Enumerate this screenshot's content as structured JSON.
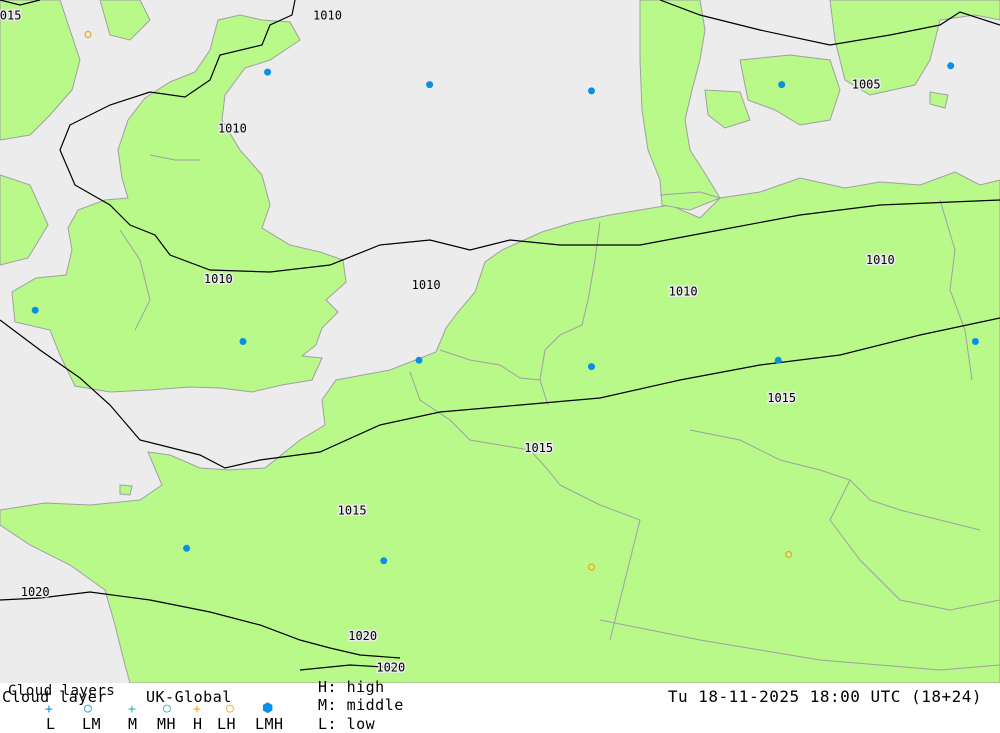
{
  "map": {
    "colors": {
      "sea": "#ececec",
      "land": "#b8f98a",
      "border": "#a0a0a0",
      "isobar": "#000000",
      "cloud_dot": "#0a8fe6",
      "low_ring": "#f4a21a"
    },
    "isobar_labels": [
      {
        "text": "015",
        "lon": -10.9,
        "lat": 59.4
      },
      {
        "text": "1010",
        "lon": -1.9,
        "lat": 59.4
      },
      {
        "text": "1010",
        "lon": -4.6,
        "lat": 57.6
      },
      {
        "text": "1005",
        "lon": 13.4,
        "lat": 58.3
      },
      {
        "text": "1010",
        "lon": -5.0,
        "lat": 55.2
      },
      {
        "text": "1010",
        "lon": 0.9,
        "lat": 55.1
      },
      {
        "text": "1010",
        "lon": 8.2,
        "lat": 55.0
      },
      {
        "text": "1010",
        "lon": 13.8,
        "lat": 55.5
      },
      {
        "text": "1015",
        "lon": 11.0,
        "lat": 53.3
      },
      {
        "text": "1015",
        "lon": 4.1,
        "lat": 52.5
      },
      {
        "text": "1015",
        "lon": -1.2,
        "lat": 51.5
      },
      {
        "text": "1020",
        "lon": -10.2,
        "lat": 50.2
      },
      {
        "text": "1020",
        "lon": -0.9,
        "lat": 49.5
      },
      {
        "text": "1020",
        "lon": -0.1,
        "lat": 49.0
      }
    ],
    "cloud_symbols": [
      {
        "type": "LMH",
        "lon": -3.6,
        "lat": 58.5
      },
      {
        "type": "LMH",
        "lon": 1.0,
        "lat": 58.3
      },
      {
        "type": "LMH",
        "lon": 5.6,
        "lat": 58.2
      },
      {
        "type": "LMH",
        "lon": 11.0,
        "lat": 58.3
      },
      {
        "type": "LMH",
        "lon": 15.8,
        "lat": 58.6
      },
      {
        "type": "LMH",
        "lon": -10.2,
        "lat": 54.7
      },
      {
        "type": "LMH",
        "lon": -4.3,
        "lat": 54.2
      },
      {
        "type": "LMH",
        "lon": 0.7,
        "lat": 53.9
      },
      {
        "type": "LMH",
        "lon": 5.6,
        "lat": 53.8
      },
      {
        "type": "LMH",
        "lon": 10.9,
        "lat": 53.9
      },
      {
        "type": "LMH",
        "lon": 16.5,
        "lat": 54.2
      },
      {
        "type": "LMH",
        "lon": -5.9,
        "lat": 50.9
      },
      {
        "type": "LMH",
        "lon": -0.3,
        "lat": 50.7
      },
      {
        "type": "LH",
        "lon": 5.6,
        "lat": 50.6
      },
      {
        "type": "LH",
        "lon": 11.2,
        "lat": 50.8
      },
      {
        "type": "LH",
        "lon": -8.7,
        "lat": 59.1
      }
    ]
  },
  "legend": {
    "title": "Cloud layer",
    "title2": "Cloud layers",
    "model": "UK-Global",
    "types": [
      "L",
      "LM",
      "M",
      "MH",
      "H",
      "LH",
      "LMH"
    ],
    "key_lines": [
      "H: high",
      "M: middle",
      "L: low"
    ],
    "datetime": "Tu 18-11-2025 18:00 UTC (18+24)"
  }
}
